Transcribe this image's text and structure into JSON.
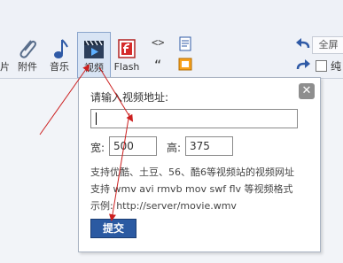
{
  "toolbar": {
    "items": [
      {
        "label": "片",
        "icon": "image-icon"
      },
      {
        "label": "附件",
        "icon": "paperclip-icon"
      },
      {
        "label": "音乐",
        "icon": "music-note-icon"
      },
      {
        "label": "视频",
        "icon": "video-clapper-icon"
      },
      {
        "label": "Flash",
        "icon": "flash-icon"
      }
    ],
    "code_glyph": "<>",
    "quote_glyph": "“",
    "fullscreen_label": "全屏",
    "plain_label": "纯"
  },
  "dialog": {
    "close_glyph": "✕",
    "prompt": "请输入视频地址:",
    "url_value": "",
    "width_label": "宽:",
    "width_value": "500",
    "height_label": "高:",
    "height_value": "375",
    "help_lines": [
      "支持优酷、土豆、56、酷6等视频站的视频网址",
      "支持 wmv avi rmvb mov swf flv 等视频格式",
      "示例: http://server/movie.wmv"
    ],
    "submit_label": "提交"
  },
  "colors": {
    "accent": "#2b5aa2",
    "annotation": "#cc1f1f"
  }
}
